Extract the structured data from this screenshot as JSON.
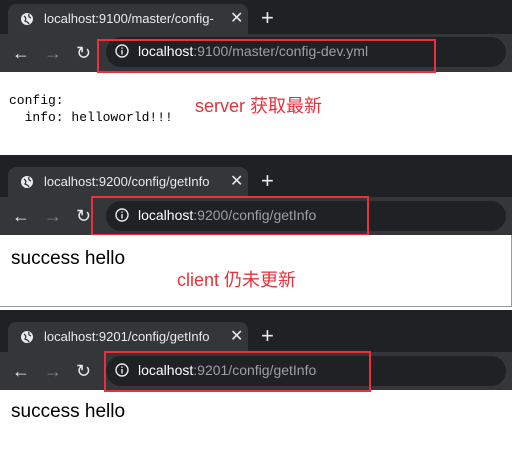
{
  "windows": [
    {
      "tab_title": "localhost:9100/master/config-",
      "url_host": "localhost",
      "url_rest": ":9100/master/config-dev.yml",
      "content_lines": [
        "config:",
        "  info: helloworld!!!"
      ],
      "annotation": "server 获取最新"
    },
    {
      "tab_title": "localhost:9200/config/getInfo",
      "url_host": "localhost",
      "url_rest": ":9200/config/getInfo",
      "content": "success hello",
      "annotation": "client 仍未更新"
    },
    {
      "tab_title": "localhost:9201/config/getInfo",
      "url_host": "localhost",
      "url_rest": ":9201/config/getInfo",
      "content": "success hello"
    }
  ],
  "icons": {
    "tab_icon": "globe-icon",
    "close": "close-icon",
    "new_tab": "plus-icon",
    "back": "back-arrow-icon",
    "forward": "forward-arrow-icon",
    "reload": "reload-icon",
    "site_info": "info-icon"
  },
  "colors": {
    "tab_strip": "#202124",
    "toolbar": "#35363a",
    "annotation_red": "#e8313c"
  }
}
